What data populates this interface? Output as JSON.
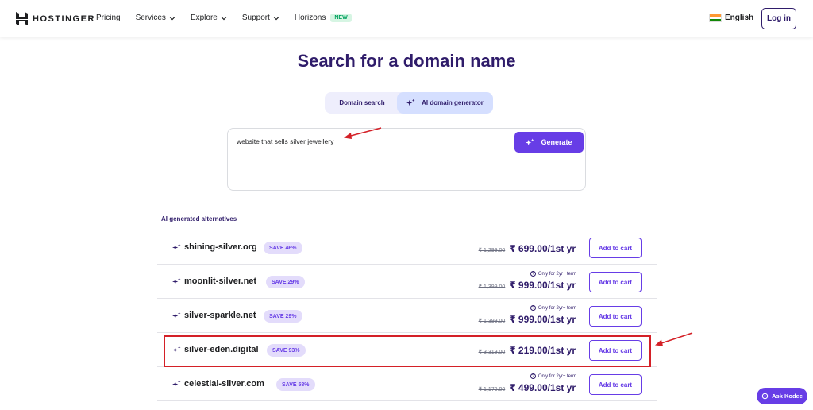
{
  "header": {
    "logo_text": "HOSTINGER",
    "nav": [
      {
        "label": "Pricing",
        "dropdown": false
      },
      {
        "label": "Services",
        "dropdown": true
      },
      {
        "label": "Explore",
        "dropdown": true
      },
      {
        "label": "Support",
        "dropdown": true
      },
      {
        "label": "Horizons",
        "dropdown": false,
        "badge": "NEW"
      }
    ],
    "language": "English",
    "login_label": "Log in"
  },
  "page_title": "Search for a domain name",
  "tabs": {
    "domain_search": "Domain search",
    "ai_generator": "AI domain generator",
    "active": "ai_generator"
  },
  "search": {
    "value": "website that sells silver jewellery",
    "generate_label": "Generate"
  },
  "section_label": "AI generated alternatives",
  "results": [
    {
      "domain": "shining-silver.org",
      "save": "SAVE 46%",
      "note": "",
      "old_price": "₹ 1,299.00",
      "price": "₹ 699.00/1st yr",
      "cart_label": "Add to cart"
    },
    {
      "domain": "moonlit-silver.net",
      "save": "SAVE 29%",
      "note": "Only for 2yr+ term",
      "old_price": "₹ 1,399.00",
      "price": "₹ 999.00/1st yr",
      "cart_label": "Add to cart"
    },
    {
      "domain": "silver-sparkle.net",
      "save": "SAVE 29%",
      "note": "Only for 2yr+ term",
      "old_price": "₹ 1,399.00",
      "price": "₹ 999.00/1st yr",
      "cart_label": "Add to cart"
    },
    {
      "domain": "silver-eden.digital",
      "save": "SAVE 93%",
      "note": "",
      "old_price": "₹ 3,319.00",
      "price": "₹ 219.00/1st yr",
      "cart_label": "Add to cart",
      "highlighted": true
    },
    {
      "domain": "celestial-silver.com",
      "save": "SAVE 58%",
      "note": "Only for 2yr+ term",
      "old_price": "₹ 1,179.00",
      "price": "₹ 499.00/1st yr",
      "cart_label": "Add to cart"
    }
  ],
  "kodee_label": "Ask Kodee",
  "colors": {
    "brand_purple": "#673de6",
    "dark_purple": "#2f1c6a",
    "annotation_red": "#d42027",
    "save_badge_bg": "#e3dcfb"
  },
  "icons": [
    "hostinger-logo-icon",
    "chevron-down-icon",
    "india-flag-icon",
    "sparkle-icon",
    "info-icon",
    "kodee-icon"
  ]
}
